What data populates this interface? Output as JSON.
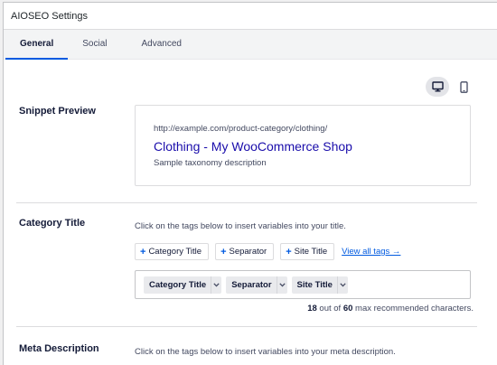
{
  "panel": {
    "title": "AIOSEO Settings"
  },
  "tabs": [
    {
      "label": "General",
      "active": true
    },
    {
      "label": "Social",
      "active": false
    },
    {
      "label": "Advanced",
      "active": false
    }
  ],
  "device_toggle": {
    "desktop": "desktop-icon",
    "mobile": "mobile-icon",
    "selected": "desktop"
  },
  "snippet": {
    "label": "Snippet Preview",
    "url": "http://example.com/product-category/clothing/",
    "title": "Clothing - My WooCommerce Shop",
    "description": "Sample taxonomy description"
  },
  "category_title": {
    "label": "Category Title",
    "helper": "Click on the tags below to insert variables into your title.",
    "tag_buttons": [
      "Category Title",
      "Separator",
      "Site Title"
    ],
    "view_all": "View all tags →",
    "chips": [
      "Category Title",
      "Separator",
      "Site Title"
    ],
    "count": "18",
    "count_suffix": " out of ",
    "max": "60",
    "max_suffix": " max recommended characters."
  },
  "meta_description": {
    "label": "Meta Description",
    "helper": "Click on the tags below to insert variables into your meta description."
  },
  "colors": {
    "accent": "#005ae0",
    "link": "#1a0dab"
  }
}
